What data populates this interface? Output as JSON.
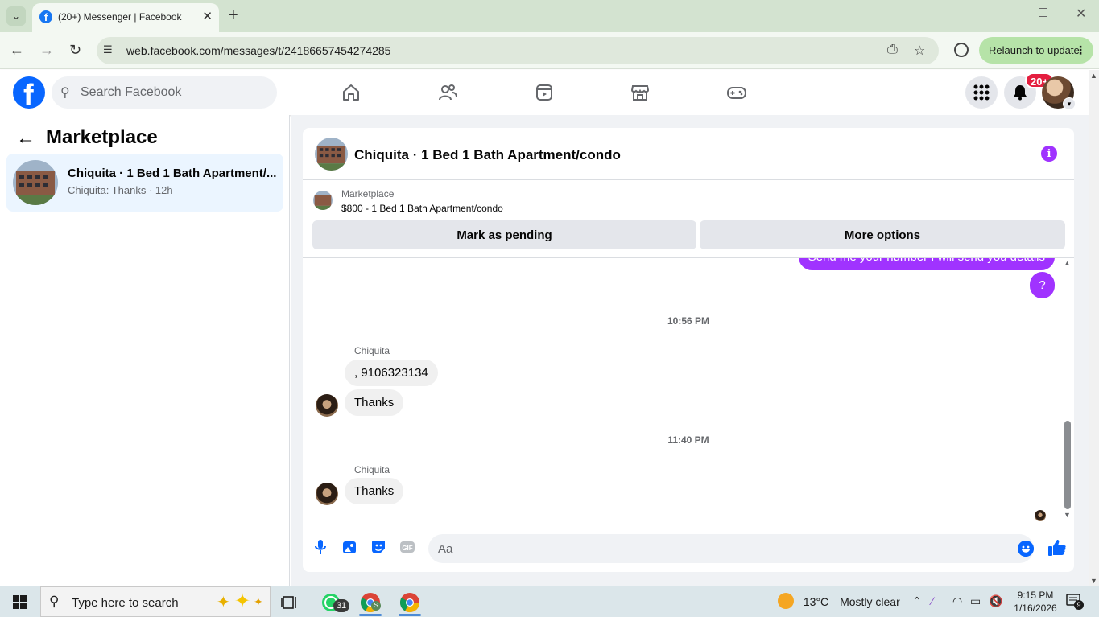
{
  "browser": {
    "tab_title": "(20+) Messenger | Facebook",
    "url": "web.facebook.com/messages/t/24186657454274285",
    "relaunch_label": "Relaunch to update"
  },
  "facebook": {
    "search_placeholder": "Search Facebook",
    "notification_count": "20+",
    "nav_icons": [
      "home-icon",
      "friends-icon",
      "watch-icon",
      "marketplace-icon",
      "gaming-icon"
    ]
  },
  "sidebar": {
    "title": "Marketplace",
    "conversations": [
      {
        "name": "Chiquita · 1 Bed 1 Bath Apartment/...",
        "snippet": "Chiquita: Thanks · 12h"
      }
    ]
  },
  "chat": {
    "title": "Chiquita · 1 Bed 1 Bath Apartment/condo",
    "listing_source": "Marketplace",
    "listing_price": "$800 - 1 Bed 1 Bath Apartment/condo",
    "mark_pending_label": "Mark as pending",
    "more_options_label": "More options",
    "composer_placeholder": "Aa",
    "accent_color": "#a033ff",
    "messages": [
      {
        "type": "out",
        "text": "Send me your number I will send you details"
      },
      {
        "type": "out",
        "text": "?"
      },
      {
        "type": "time",
        "text": "10:56 PM"
      },
      {
        "type": "sender",
        "text": "Chiquita"
      },
      {
        "type": "in",
        "text": ", 9106323134"
      },
      {
        "type": "in",
        "text": "Thanks"
      },
      {
        "type": "time",
        "text": "11:40 PM"
      },
      {
        "type": "sender",
        "text": "Chiquita"
      },
      {
        "type": "in",
        "text": "Thanks"
      }
    ]
  },
  "taskbar": {
    "search_placeholder": "Type here to search",
    "whatsapp_badge": "31",
    "chrome_badge": "S",
    "weather_temp": "13°C",
    "weather_desc": "Mostly clear",
    "time": "9:15 PM",
    "date": "1/16/2026",
    "notification_count": "9"
  }
}
